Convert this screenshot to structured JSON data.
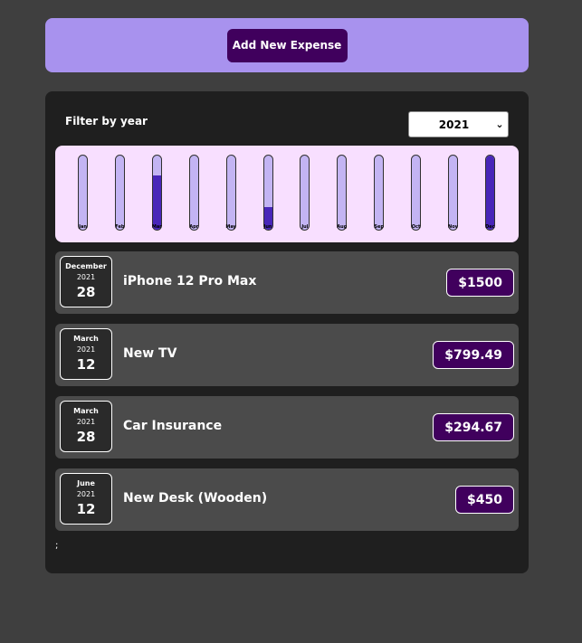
{
  "new_expense": {
    "add_button_label": "Add New Expense"
  },
  "filter": {
    "label": "Filter by year",
    "selected_year": "2021",
    "chevron": "⌄"
  },
  "chart_data": {
    "type": "bar",
    "categories": [
      "Jan",
      "Feb",
      "Mar",
      "Apr",
      "May",
      "Jun",
      "Jul",
      "Aug",
      "Sep",
      "Oct",
      "Nov",
      "Dec"
    ],
    "values": [
      0,
      0,
      1094.16,
      0,
      0,
      450,
      0,
      0,
      0,
      0,
      0,
      1500
    ],
    "max_value": 1500
  },
  "expenses": [
    {
      "month": "December",
      "year": "2021",
      "day": "28",
      "title": "iPhone 12 Pro Max",
      "amount": "$1500"
    },
    {
      "month": "March",
      "year": "2021",
      "day": "12",
      "title": "New TV",
      "amount": "$799.49"
    },
    {
      "month": "March",
      "year": "2021",
      "day": "28",
      "title": "Car Insurance",
      "amount": "$294.67"
    },
    {
      "month": "June",
      "year": "2021",
      "day": "12",
      "title": "New Desk (Wooden)",
      "amount": "$450"
    }
  ],
  "stray_text": ";"
}
